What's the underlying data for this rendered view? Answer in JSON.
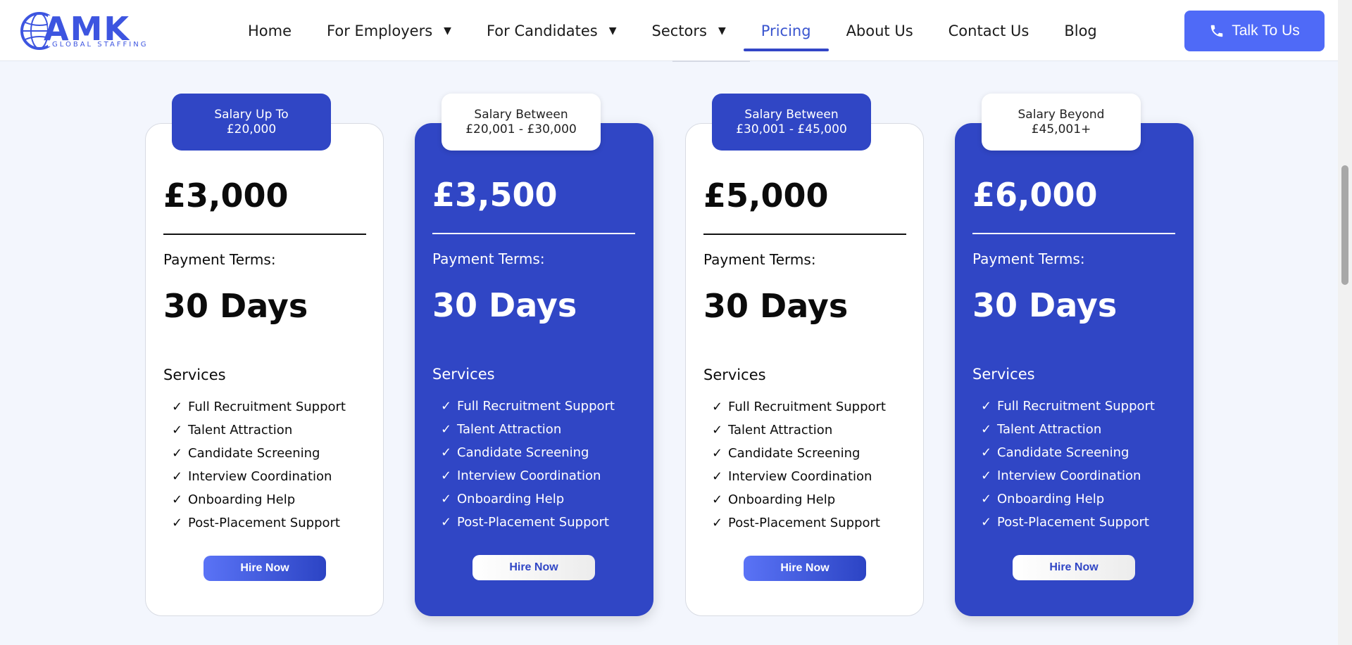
{
  "brand": {
    "name": "AMK",
    "tagline": "GLOBAL STAFFING",
    "accent": "#3d55e0"
  },
  "nav": {
    "items": [
      {
        "label": "Home",
        "dropdown": false,
        "active": false
      },
      {
        "label": "For Employers",
        "dropdown": true,
        "active": false
      },
      {
        "label": "For Candidates",
        "dropdown": true,
        "active": false
      },
      {
        "label": "Sectors",
        "dropdown": true,
        "active": false
      },
      {
        "label": "Pricing",
        "dropdown": false,
        "active": true
      },
      {
        "label": "About Us",
        "dropdown": false,
        "active": false
      },
      {
        "label": "Contact Us",
        "dropdown": false,
        "active": false
      },
      {
        "label": "Blog",
        "dropdown": false,
        "active": false
      }
    ],
    "cta_label": "Talk To Us",
    "cta_icon": "phone-icon"
  },
  "colors": {
    "card_blue": "#3046c5",
    "cta_blue": "#4f6af7",
    "active_nav": "#3a55cf",
    "background": "#f3f6fd"
  },
  "pricing": {
    "cards": [
      {
        "tag_line1": "Salary Up To",
        "tag_line2": "£20,000",
        "price": "£3,000",
        "terms_label": "Payment Terms:",
        "terms_value": "30 Days",
        "services_label": "Services",
        "services": [
          "Full Recruitment Support",
          "Talent Attraction",
          "Candidate Screening",
          "Interview Coordination",
          "Onboarding Help",
          "Post-Placement Support"
        ],
        "button": "Hire Now",
        "style": "white"
      },
      {
        "tag_line1": "Salary Between",
        "tag_line2": "£20,001 - £30,000",
        "price": "£3,500",
        "terms_label": "Payment Terms:",
        "terms_value": "30 Days",
        "services_label": "Services",
        "services": [
          "Full Recruitment Support",
          "Talent Attraction",
          "Candidate Screening",
          "Interview Coordination",
          "Onboarding Help",
          "Post-Placement Support"
        ],
        "button": "Hire Now",
        "style": "blue"
      },
      {
        "tag_line1": "Salary Between",
        "tag_line2": "£30,001 - £45,000",
        "price": "£5,000",
        "terms_label": "Payment Terms:",
        "terms_value": "30 Days",
        "services_label": "Services",
        "services": [
          "Full Recruitment Support",
          "Talent Attraction",
          "Candidate Screening",
          "Interview Coordination",
          "Onboarding Help",
          "Post-Placement Support"
        ],
        "button": "Hire Now",
        "style": "white"
      },
      {
        "tag_line1": "Salary Beyond",
        "tag_line2": "£45,001+",
        "price": "£6,000",
        "terms_label": "Payment Terms:",
        "terms_value": "30 Days",
        "services_label": "Services",
        "services": [
          "Full Recruitment Support",
          "Talent Attraction",
          "Candidate Screening",
          "Interview Coordination",
          "Onboarding Help",
          "Post-Placement Support"
        ],
        "button": "Hire Now",
        "style": "blue"
      }
    ],
    "check_glyph": "✓"
  }
}
